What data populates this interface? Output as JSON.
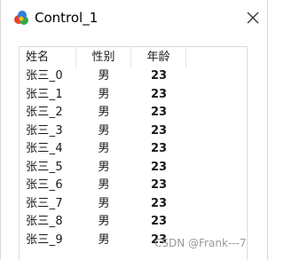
{
  "window": {
    "title": "Control_1",
    "close_label": "×"
  },
  "list": {
    "columns": [
      "姓名",
      "性别",
      "年龄"
    ],
    "rows": [
      {
        "name": "张三_0",
        "gender": "男",
        "age": "23"
      },
      {
        "name": "张三_1",
        "gender": "男",
        "age": "23"
      },
      {
        "name": "张三_2",
        "gender": "男",
        "age": "23"
      },
      {
        "name": "张三_3",
        "gender": "男",
        "age": "23"
      },
      {
        "name": "张三_4",
        "gender": "男",
        "age": "23"
      },
      {
        "name": "张三_5",
        "gender": "男",
        "age": "23"
      },
      {
        "name": "张三_6",
        "gender": "男",
        "age": "23"
      },
      {
        "name": "张三_7",
        "gender": "男",
        "age": "23"
      },
      {
        "name": "张三_8",
        "gender": "男",
        "age": "23"
      },
      {
        "name": "张三_9",
        "gender": "男",
        "age": "23"
      }
    ]
  },
  "watermark": "CSDN @Frank---7",
  "colors": {
    "text": "#1a1a1a",
    "border": "#dcdcdc",
    "watermark": "#9a9a9a"
  }
}
